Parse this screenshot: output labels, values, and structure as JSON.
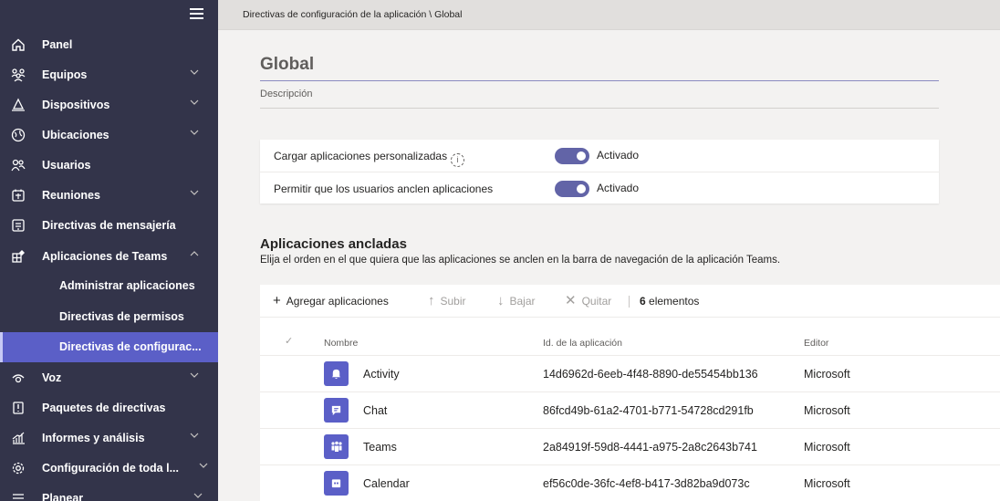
{
  "sidebar": {
    "items": [
      {
        "label": "Panel",
        "icon": "home-icon"
      },
      {
        "label": "Equipos",
        "icon": "teams-icon"
      },
      {
        "label": "Dispositivos",
        "icon": "devices-icon"
      },
      {
        "label": "Ubicaciones",
        "icon": "globe-icon"
      },
      {
        "label": "Usuarios",
        "icon": "users-icon"
      },
      {
        "label": "Reuniones",
        "icon": "calendar-icon"
      },
      {
        "label": "Directivas de mensajería",
        "icon": "messaging-icon"
      },
      {
        "label": "Aplicaciones de Teams",
        "icon": "apps-icon"
      },
      {
        "label": "Voz",
        "icon": "voice-icon"
      },
      {
        "label": "Paquetes de directivas",
        "icon": "policy-package-icon"
      },
      {
        "label": "Informes y análisis",
        "icon": "chart-icon"
      },
      {
        "label": "Configuración de toda l...",
        "icon": "settings-icon"
      },
      {
        "label": "Planear",
        "icon": "planning-icon"
      }
    ],
    "subitems": [
      {
        "label": "Administrar aplicaciones"
      },
      {
        "label": "Directivas de permisos"
      },
      {
        "label": "Directivas de configurac..."
      }
    ]
  },
  "breadcrumb": "Directivas de configuración de la aplicación \\ Global",
  "page": {
    "title": "Global",
    "description_placeholder": "Descripción"
  },
  "settings": [
    {
      "label": "Cargar aplicaciones personalizadas",
      "value": "Activado"
    },
    {
      "label": "Permitir que los usuarios anclen aplicaciones",
      "value": "Activado"
    }
  ],
  "pinned": {
    "title": "Aplicaciones ancladas",
    "description": "Elija el orden en el que quiera que las aplicaciones se anclen en la barra de navegación de la aplicación Teams.",
    "toolbar": {
      "add": "Agregar aplicaciones",
      "up": "Subir",
      "down": "Bajar",
      "remove": "Quitar",
      "count_number": "6",
      "count_label": "elementos"
    },
    "columns": {
      "name": "Nombre",
      "id": "Id. de la aplicación",
      "publisher": "Editor"
    },
    "rows": [
      {
        "name": "Activity",
        "id": "14d6962d-6eeb-4f48-8890-de55454bb136",
        "publisher": "Microsoft",
        "icon": "bell-icon"
      },
      {
        "name": "Chat",
        "id": "86fcd49b-61a2-4701-b771-54728cd291fb",
        "publisher": "Microsoft",
        "icon": "chat-icon"
      },
      {
        "name": "Teams",
        "id": "2a84919f-59d8-4441-a975-2a8c2643b741",
        "publisher": "Microsoft",
        "icon": "teams-app-icon"
      },
      {
        "name": "Calendar",
        "id": "ef56c0de-36fc-4ef8-b417-3d82ba9d073c",
        "publisher": "Microsoft",
        "icon": "calendar-app-icon"
      }
    ]
  },
  "colors": {
    "sidebar": "#33344a",
    "accent": "#5b5fc7",
    "toggle": "#6264a7"
  }
}
